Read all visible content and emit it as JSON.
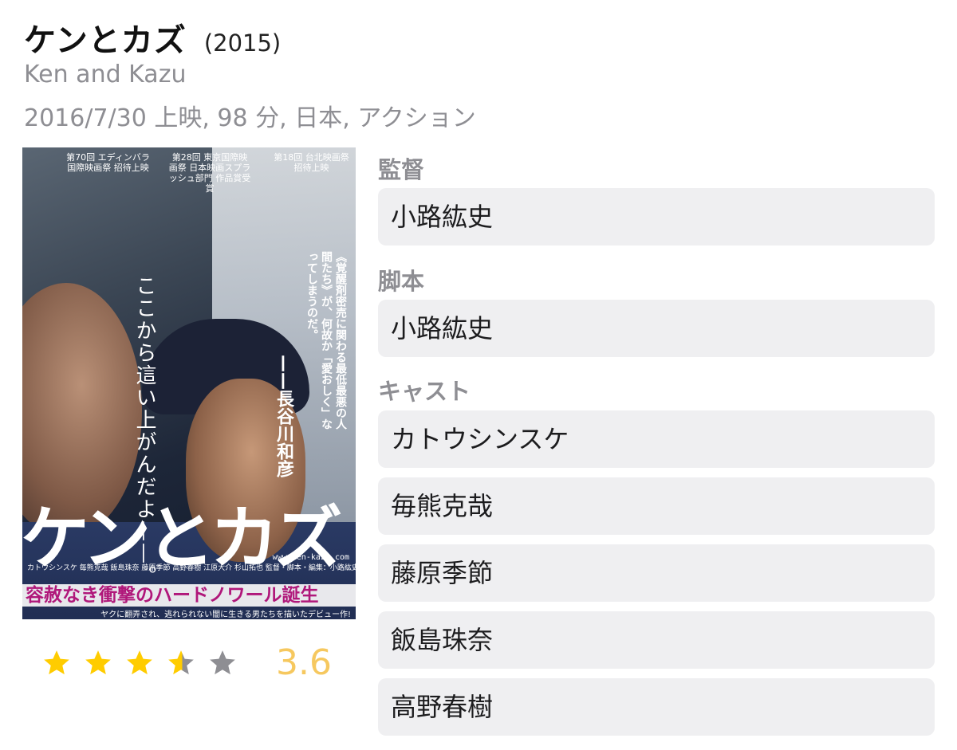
{
  "movie": {
    "title": "ケンとカズ",
    "year": "(2015)",
    "original_title": "Ken and Kazu",
    "meta": "2016/7/30 上映, 98 分, 日本, アクション"
  },
  "poster": {
    "festivals": [
      "第70回 エディンバラ 国際映画祭 招待上映",
      "第28回 東京国際映画祭 日本映画スプラッシュ部門 作品賞受賞",
      "第18回 台北映画祭 招待上映"
    ],
    "tagline_vertical": "ここから這い上がんだよ——。",
    "quote": "《覚醒剤密売に関わる最低最悪の人間たち》が、何故か「愛おしく」なってしまうのだ。",
    "quote_author": "——長谷川和彦",
    "title": "ケンとカズ",
    "url": "www.ken-kazu.com",
    "credits": "カトウシンスケ 毎熊克哉 飯島珠奈 藤原季節 高野春樹 江原大介 杉山拓也 監督・脚本・編集：小路紘史",
    "headline": "容赦なき衝撃のハードノワール誕生",
    "subline": "ヤクに翻弄され、逃れられない闇に生きる男たちを描いたデビュー作!"
  },
  "rating": {
    "value": 3.6,
    "display": "3.6",
    "max": 5,
    "filled_color": "#FFCC00",
    "empty_color": "#8E8E93",
    "score_color": "#F6C85F"
  },
  "sections": {
    "director_label": "監督",
    "director": "小路紘史",
    "writer_label": "脚本",
    "writer": "小路紘史",
    "cast_label": "キャスト",
    "cast": [
      "カトウシンスケ",
      "毎熊克哉",
      "藤原季節",
      "飯島珠奈",
      "高野春樹"
    ]
  }
}
